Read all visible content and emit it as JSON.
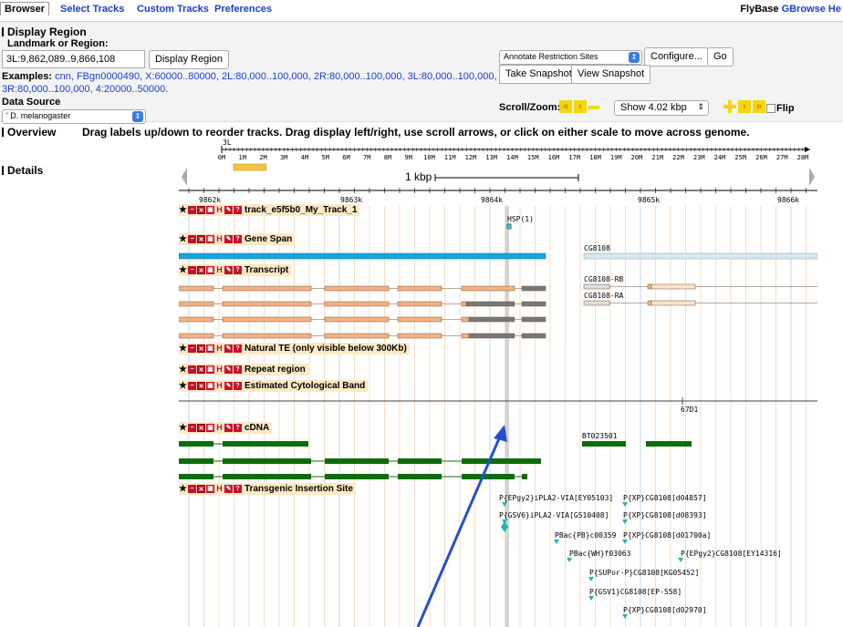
{
  "tabs": [
    "Browser",
    "Select Tracks",
    "Custom Tracks",
    "Preferences"
  ],
  "help": {
    "prefix": "FlyBase ",
    "link": "GBrowse He"
  },
  "display_region": {
    "title": "Display Region",
    "landmark_label": "Landmark or Region:",
    "landmark_value": "3L:9,862,089..9,866,108",
    "display_button": "Display Region",
    "examples_label": "Examples:",
    "examples_line1": "cnn, FBgn0000490, X:60000..80000, 2L:80,000..100,000, 2R:80,000..100,000, 3L:80,000..100,000,",
    "examples_line2": "3R:80,000..100,000, 4:20000..50000.",
    "data_source_label": "Data Source",
    "data_source_value": "' D. melanogaster",
    "annotate_select": "Annotate Restriction Sites",
    "configure_button": "Configure...",
    "go_button": "Go",
    "snapshot_button": "Take Snapshot",
    "view_snapshot_button": "View Snapshot",
    "scroll_zoom_label": "Scroll/Zoom:",
    "show_select": "Show 4.02 kbp",
    "flip_label": "Flip"
  },
  "overview": {
    "title": "Overview",
    "hint": "Drag labels up/down to reorder tracks. Drag display left/right, use scroll arrows, or click on either scale to move across genome.",
    "chrom": "3L",
    "ticks": [
      "0M",
      "1M",
      "2M",
      "3M",
      "4M",
      "5M",
      "6M",
      "7M",
      "8M",
      "9M",
      "10M",
      "11M",
      "12M",
      "13M",
      "14M",
      "15M",
      "16M",
      "17M",
      "18M",
      "19M",
      "20M",
      "21M",
      "22M",
      "23M",
      "24M",
      "25M",
      "26M",
      "27M",
      "28M"
    ]
  },
  "details": {
    "title": "Details",
    "scale_label": "1 kbp",
    "ruler": [
      "9862k",
      "9863k",
      "9864k",
      "9865k",
      "9866k"
    ]
  },
  "tracks": {
    "custom": "track_e5f5b0_My_Track_1",
    "custom_feature": "HSP(1)",
    "gene_span": "Gene Span",
    "gene_span_feature": "CG8108",
    "transcript": "Transcript",
    "transcript_rb": "CG8108-RB",
    "transcript_ra": "CG8108-RA",
    "natural_te": "Natural TE (only visible below 300Kb)",
    "repeat": "Repeat region",
    "cyto": "Estimated Cytological Band",
    "cyto_feature": "67D1",
    "cdna": "cDNA",
    "cdna_feature": "BT023501",
    "transgenic": "Transgenic Insertion Site",
    "insertions": [
      "P{EPgy2}iPLA2-VIA[EY05103]",
      "P{XP}CG8108[d04857]",
      "P{GSV6}iPLA2-VIA[GS10408]",
      "P{XP}CG8108[d08393]",
      "PBac{PB}c00359",
      "P{XP}CG8108[d01700a]",
      "PBac{WH}f03063",
      "P{EPgy2}CG8108[EY14316]",
      "P{SUPor-P}CG8108[KG05452]",
      "P{GSV1}CG8108[EP-558]",
      "P{XP}CG8108[d02970]"
    ]
  },
  "colors": {
    "link": "#1a3fd0",
    "gene_span": "#1ba3dd",
    "transcript_fill": "#f4b183",
    "cdna": "#0f6b0f",
    "insertion": "#1fb5b5",
    "arrow": "#2550c8",
    "track_label_bg": "#fde9c4"
  }
}
